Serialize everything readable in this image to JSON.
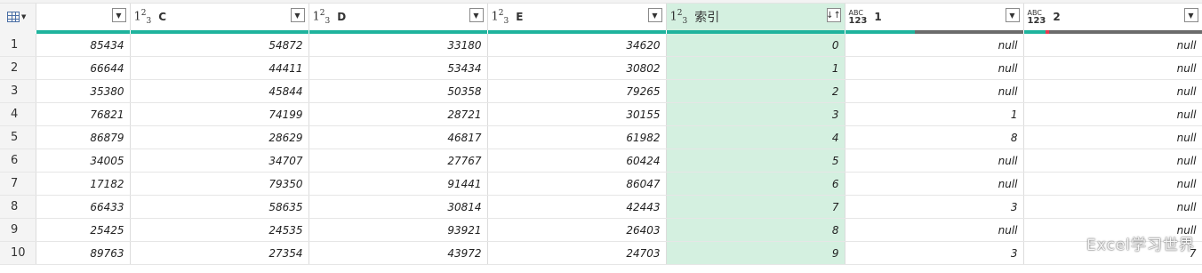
{
  "columns": [
    {
      "key": "b",
      "type": "none",
      "name": ""
    },
    {
      "key": "c",
      "type": "123",
      "name": "C"
    },
    {
      "key": "d",
      "type": "123",
      "name": "D"
    },
    {
      "key": "e",
      "type": "123",
      "name": "E"
    },
    {
      "key": "idx",
      "type": "123",
      "name": "索引",
      "sorted": true
    },
    {
      "key": "c1",
      "type": "ABC123",
      "name": "1"
    },
    {
      "key": "c2",
      "type": "ABC123",
      "name": "2"
    }
  ],
  "type_labels": {
    "num": "1²₃",
    "abc_top": "ABC",
    "abc_bottom": "123"
  },
  "icons": {
    "dropdown": "chevron-down-icon",
    "sort": "sort-ascending-icon",
    "corner": "table-icon"
  },
  "colors": {
    "quality_valid": "#1fb39d",
    "quality_empty": "#6b6b6b",
    "sorted_column": "#d4f0e0"
  },
  "rows": [
    {
      "n": "1",
      "b": "85434",
      "c": "54872",
      "d": "33180",
      "e": "34620",
      "idx": "0",
      "c1": "null",
      "c2": "null"
    },
    {
      "n": "2",
      "b": "66644",
      "c": "44411",
      "d": "53434",
      "e": "30802",
      "idx": "1",
      "c1": "null",
      "c2": "null"
    },
    {
      "n": "3",
      "b": "35380",
      "c": "45844",
      "d": "50358",
      "e": "79265",
      "idx": "2",
      "c1": "null",
      "c2": "null"
    },
    {
      "n": "4",
      "b": "76821",
      "c": "74199",
      "d": "28721",
      "e": "30155",
      "idx": "3",
      "c1": "1",
      "c2": "null"
    },
    {
      "n": "5",
      "b": "86879",
      "c": "28629",
      "d": "46817",
      "e": "61982",
      "idx": "4",
      "c1": "8",
      "c2": "null"
    },
    {
      "n": "6",
      "b": "34005",
      "c": "34707",
      "d": "27767",
      "e": "60424",
      "idx": "5",
      "c1": "null",
      "c2": "null"
    },
    {
      "n": "7",
      "b": "17182",
      "c": "79350",
      "d": "91441",
      "e": "86047",
      "idx": "6",
      "c1": "null",
      "c2": "null"
    },
    {
      "n": "8",
      "b": "66433",
      "c": "58635",
      "d": "30814",
      "e": "42443",
      "idx": "7",
      "c1": "3",
      "c2": "null"
    },
    {
      "n": "9",
      "b": "25425",
      "c": "24535",
      "d": "93921",
      "e": "26403",
      "idx": "8",
      "c1": "null",
      "c2": "null"
    },
    {
      "n": "10",
      "b": "89763",
      "c": "27354",
      "d": "43972",
      "e": "24703",
      "idx": "9",
      "c1": "3",
      "c2": "7"
    }
  ],
  "watermark": "Excel学习世界"
}
